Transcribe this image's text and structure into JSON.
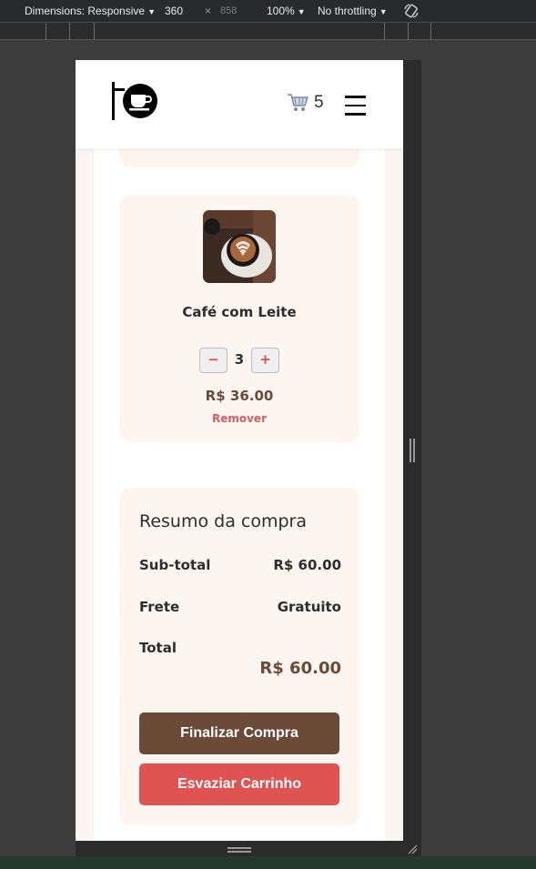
{
  "devtools": {
    "dimensions_label": "Dimensions: Responsive",
    "width": "360",
    "separator": "×",
    "height": "858",
    "zoom": "100%",
    "throttling": "No throttling"
  },
  "header": {
    "logo_icon": "coffee-sign-icon",
    "cart_icon": "shopping-cart-icon",
    "cart_count": "5",
    "menu_icon": "hamburger-menu-icon"
  },
  "cart": {
    "items": [
      {
        "name": "Café com Leite",
        "quantity": "3",
        "minus_label": "−",
        "plus_label": "+",
        "price": "R$ 36.00",
        "remove_label": "Remover"
      }
    ]
  },
  "summary": {
    "title": "Resumo da compra",
    "subtotal_label": "Sub-total",
    "subtotal_value": "R$ 60.00",
    "shipping_label": "Frete",
    "shipping_value": "Gratuito",
    "total_label": "Total",
    "total_value": "R$ 60.00",
    "finish_label": "Finalizar Compra",
    "empty_label": "Esvaziar Carrinho"
  },
  "colors": {
    "brown": "#6b4a37",
    "red": "#e05353",
    "card_bg": "#fdf5f0"
  }
}
